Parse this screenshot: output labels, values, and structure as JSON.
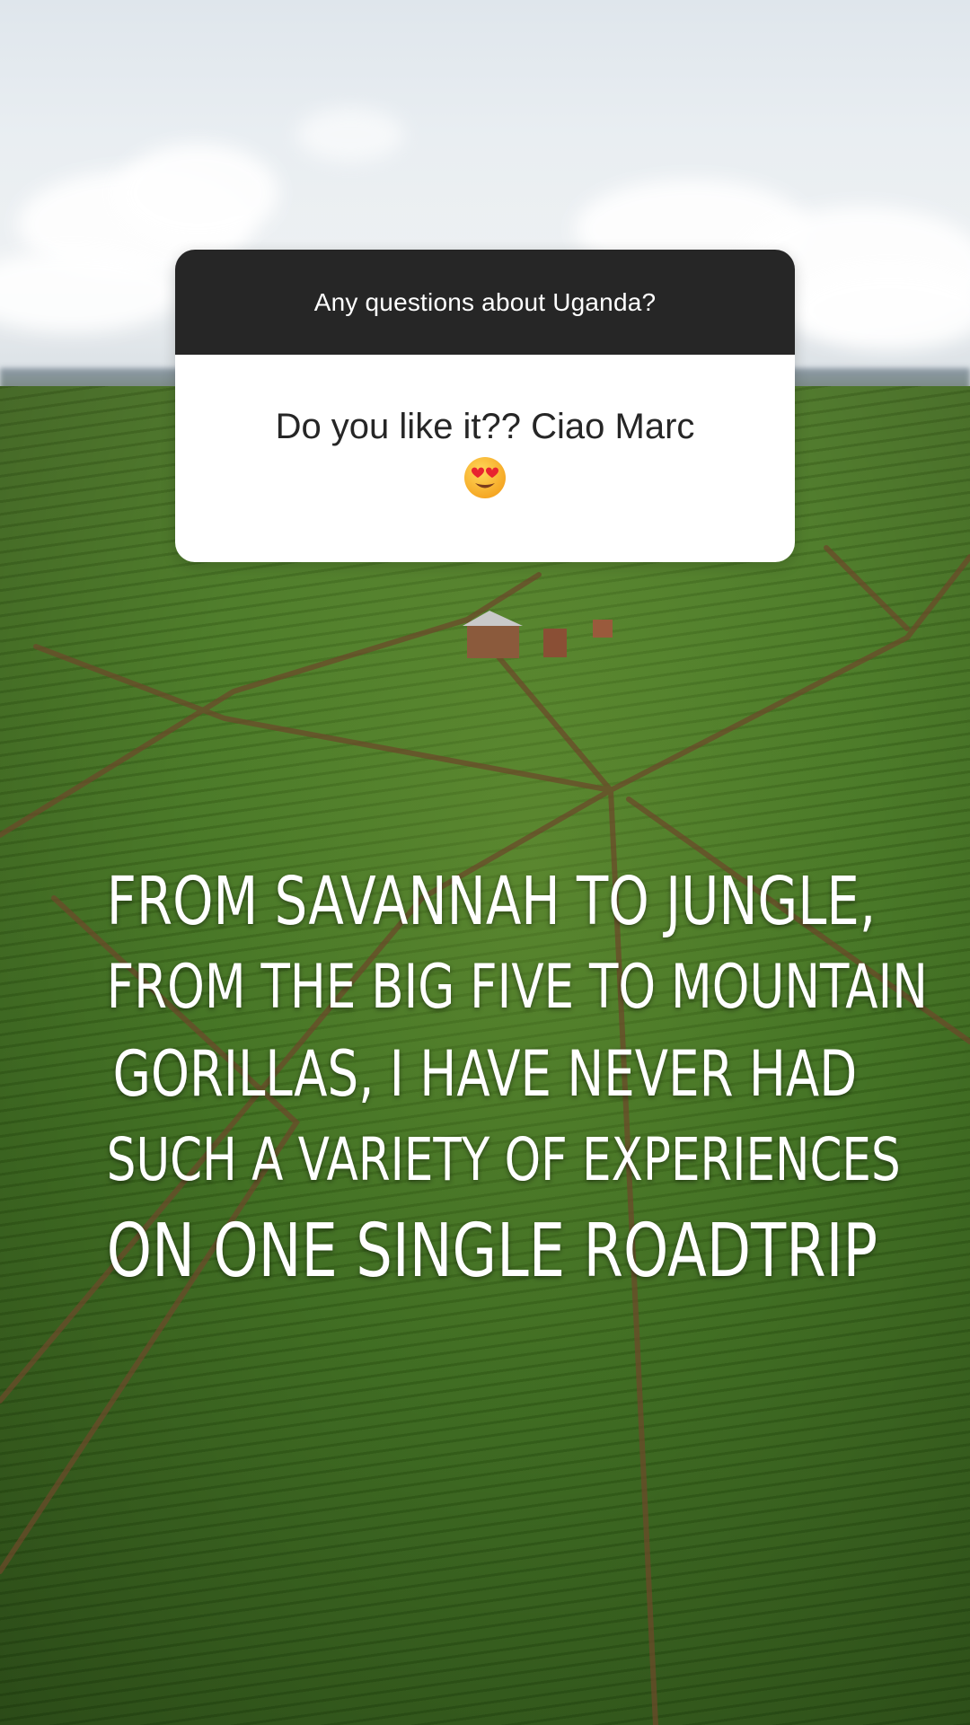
{
  "question_sticker": {
    "prompt": "Any questions about Uganda?",
    "answer": "Do you like it?? Ciao Marc",
    "emoji": "heart-eyes-emoji"
  },
  "caption": {
    "lines": [
      "FROM SAVANNAH TO JUNGLE,",
      "FROM THE BIG FIVE TO MOUNTAIN",
      "GORILLAS, I HAVE NEVER HAD",
      "SUCH A VARIETY OF EXPERIENCES",
      "ON ONE SINGLE ROADTRIP"
    ]
  },
  "colors": {
    "sticker_header": "#262626",
    "sticker_body": "#ffffff",
    "caption_text": "#ffffff"
  }
}
